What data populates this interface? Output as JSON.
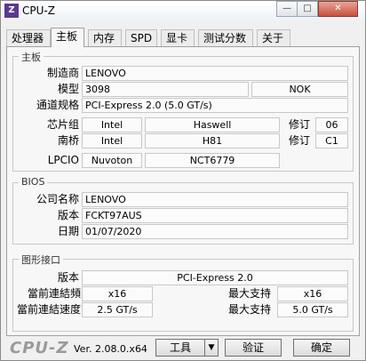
{
  "window": {
    "title": "CPU-Z",
    "icon": "cpu-z-app-icon",
    "min": "—",
    "max": "□",
    "close": "✕"
  },
  "tabs": [
    "处理器",
    "主板",
    "内存",
    "SPD",
    "显卡",
    "测试分数",
    "关于"
  ],
  "motherboard": {
    "group_title": "主板",
    "manufacturer_label": "制造商",
    "manufacturer": "LENOVO",
    "model_label": "模型",
    "model": "3098",
    "model_rev": "NOK",
    "bus_label": "通道规格",
    "bus": "PCI-Express 2.0 (5.0 GT/s)",
    "chipset_label": "芯片组",
    "chipset_vendor": "Intel",
    "chipset_model": "Haswell",
    "chipset_rev_label": "修订",
    "chipset_rev": "06",
    "southbridge_label": "南桥",
    "sb_vendor": "Intel",
    "sb_model": "H81",
    "sb_rev_label": "修订",
    "sb_rev": "C1",
    "lpcio_label": "LPCIO",
    "lpcio_vendor": "Nuvoton",
    "lpcio_model": "NCT6779"
  },
  "bios": {
    "group_title": "BIOS",
    "brand_label": "公司名称",
    "brand": "LENOVO",
    "version_label": "版本",
    "version": "FCKT97AUS",
    "date_label": "日期",
    "date": "01/07/2020"
  },
  "graphic": {
    "group_title": "图形接口",
    "version_label": "版本",
    "version": "PCI-Express 2.0",
    "cur_width_label": "當前連結頻",
    "cur_width": "x16",
    "max_width_label": "最大支持",
    "max_width": "x16",
    "cur_speed_label": "當前連結速度",
    "cur_speed": "2.5 GT/s",
    "max_speed_label": "最大支持",
    "max_speed": "5.0 GT/s"
  },
  "footer": {
    "brand": "CPU-Z",
    "version": "Ver. 2.08.0.x64",
    "tools": "工具",
    "tools_arrow": "▼",
    "validate": "验证",
    "ok": "确定"
  }
}
